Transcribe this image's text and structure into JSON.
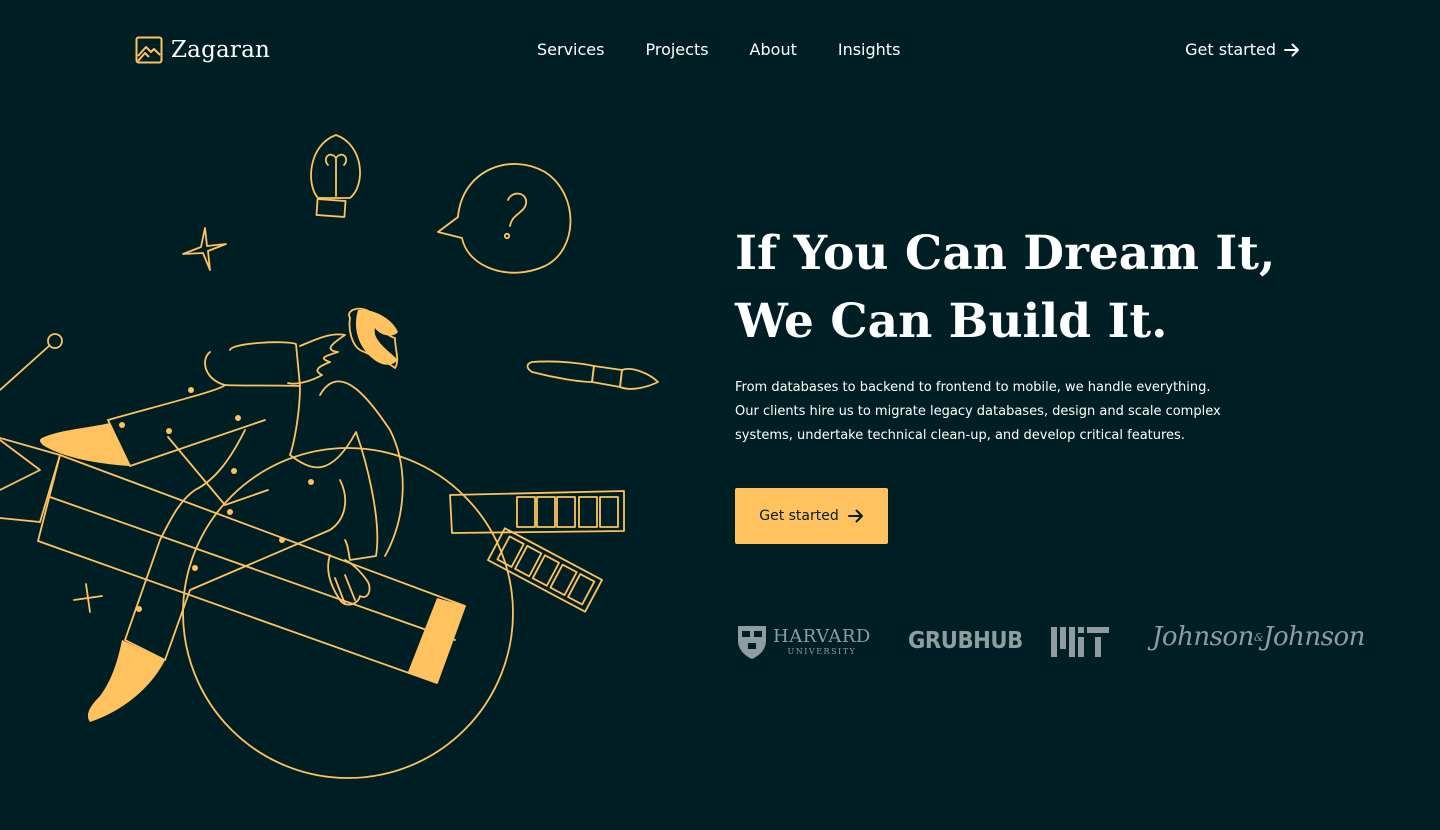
{
  "brand": {
    "name": "Zagaran",
    "logo_icon": "mountain-frame-icon"
  },
  "nav": {
    "items": [
      {
        "label": "Services"
      },
      {
        "label": "Projects"
      },
      {
        "label": "About"
      },
      {
        "label": "Insights"
      }
    ]
  },
  "header": {
    "cta_label": "Get started",
    "cta_icon": "arrow-right-icon"
  },
  "hero": {
    "title_lines": [
      "If You Can Dream It,",
      "We Can Build It."
    ],
    "description_lines": [
      "From databases to backend to frontend to mobile, we handle everything.",
      "Our clients hire us to migrate legacy databases, design and scale complex",
      "systems, undertake technical clean-up, and develop critical features."
    ],
    "cta_label": "Get started",
    "cta_icon": "arrow-right-icon"
  },
  "clients": {
    "harvard": {
      "name": "HARVARD",
      "sub": "UNIVERSITY",
      "icon": "harvard-shield-icon"
    },
    "grubhub": {
      "name": "GRUBHUB"
    },
    "mit": {
      "icon": "mit-logo"
    },
    "jnj": {
      "first": "Johnson",
      "amp": "&",
      "second": "Johnson"
    }
  },
  "colors": {
    "background": "#001f24",
    "accent": "#ffc25e",
    "text": "#ffffff",
    "logo_gray": "#8f9da0"
  }
}
